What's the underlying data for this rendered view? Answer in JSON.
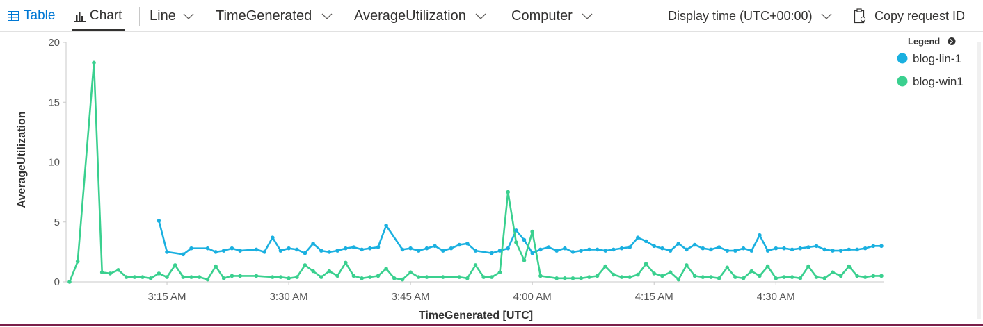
{
  "toolbar": {
    "table_label": "Table",
    "chart_label": "Chart",
    "chart_type_label": "Line",
    "x_column_label": "TimeGenerated",
    "y_column_label": "AverageUtilization",
    "split_column_label": "Computer",
    "display_time_label": "Display time (UTC+00:00)",
    "copy_request_label": "Copy request ID"
  },
  "colors": {
    "accent": "#0078d4",
    "series_lin": "#1ab0e0",
    "series_win": "#3ad08f"
  },
  "icons": [
    "table-icon",
    "chart-icon",
    "chevron-down-icon",
    "clipboard-icon",
    "legend-collapse-icon"
  ],
  "chart_data": {
    "type": "line",
    "xlabel": "TimeGenerated [UTC]",
    "ylabel": "AverageUtilization",
    "legend_title": "Legend",
    "legend_position": "top-right",
    "ylim": [
      0,
      20
    ],
    "xlim": [
      "03:03",
      "04:43"
    ],
    "x_ticks": [
      "3:15 AM",
      "3:30 AM",
      "3:45 AM",
      "4:00 AM",
      "4:15 AM",
      "4:30 AM"
    ],
    "y_ticks": [
      "0",
      "5",
      "10",
      "15",
      "20"
    ],
    "grid": false,
    "series": [
      {
        "name": "blog-lin-1",
        "color": "#1ab0e0",
        "x": [
          "03:14",
          "03:15",
          "03:17",
          "03:18",
          "03:20",
          "03:21",
          "03:22",
          "03:23",
          "03:24",
          "03:26",
          "03:27",
          "03:28",
          "03:29",
          "03:30",
          "03:31",
          "03:32",
          "03:33",
          "03:34",
          "03:35",
          "03:36",
          "03:37",
          "03:38",
          "03:39",
          "03:40",
          "03:41",
          "03:42",
          "03:44",
          "03:45",
          "03:46",
          "03:47",
          "03:48",
          "03:49",
          "03:50",
          "03:51",
          "03:52",
          "03:53",
          "03:55",
          "03:56",
          "03:57",
          "03:58",
          "03:59",
          "04:00",
          "04:01",
          "04:02",
          "04:03",
          "04:04",
          "04:05",
          "04:06",
          "04:07",
          "04:08",
          "04:09",
          "04:10",
          "04:11",
          "04:12",
          "04:13",
          "04:14",
          "04:15",
          "04:16",
          "04:17",
          "04:18",
          "04:19",
          "04:20",
          "04:21",
          "04:22",
          "04:23",
          "04:24",
          "04:25",
          "04:26",
          "04:27",
          "04:28",
          "04:29",
          "04:30",
          "04:31",
          "04:32",
          "04:33",
          "04:34",
          "04:35",
          "04:36",
          "04:37",
          "04:38",
          "04:39",
          "04:40",
          "04:41",
          "04:42",
          "04:43"
        ],
        "values": [
          5.1,
          2.5,
          2.3,
          2.8,
          2.8,
          2.5,
          2.6,
          2.8,
          2.6,
          2.7,
          2.5,
          3.7,
          2.6,
          2.8,
          2.7,
          2.4,
          3.2,
          2.6,
          2.5,
          2.6,
          2.8,
          2.9,
          2.7,
          2.8,
          2.9,
          4.7,
          2.7,
          2.8,
          2.6,
          2.8,
          3.0,
          2.6,
          2.8,
          3.1,
          3.2,
          2.6,
          2.4,
          2.6,
          2.8,
          4.3,
          3.5,
          2.4,
          2.7,
          2.9,
          2.6,
          2.8,
          2.5,
          2.6,
          2.7,
          2.7,
          2.6,
          2.7,
          2.8,
          2.9,
          3.7,
          3.4,
          3.0,
          2.8,
          2.6,
          3.2,
          2.7,
          3.1,
          2.8,
          2.7,
          2.9,
          2.6,
          2.6,
          2.8,
          2.6,
          3.9,
          2.6,
          2.8,
          2.8,
          2.7,
          2.8,
          2.9,
          3.0,
          2.7,
          2.6,
          2.6,
          2.7,
          2.7,
          2.8,
          3.0,
          3.0
        ],
        "values_note_hidden": ""
      },
      {
        "name": "blog-win1",
        "color": "#3ad08f",
        "x": [
          "03:03",
          "03:04",
          "03:06",
          "03:07",
          "03:08",
          "03:09",
          "03:10",
          "03:11",
          "03:12",
          "03:13",
          "03:14",
          "03:15",
          "03:16",
          "03:17",
          "03:18",
          "03:19",
          "03:20",
          "03:21",
          "03:22",
          "03:23",
          "03:24",
          "03:26",
          "03:28",
          "03:29",
          "03:30",
          "03:31",
          "03:32",
          "03:33",
          "03:34",
          "03:35",
          "03:36",
          "03:37",
          "03:38",
          "03:39",
          "03:40",
          "03:41",
          "03:42",
          "03:43",
          "03:44",
          "03:45",
          "03:46",
          "03:47",
          "03:49",
          "03:51",
          "03:52",
          "03:53",
          "03:54",
          "03:55",
          "03:56",
          "03:57",
          "03:58",
          "03:59",
          "04:00",
          "04:01",
          "04:03",
          "04:04",
          "04:05",
          "04:06",
          "04:07",
          "04:08",
          "04:09",
          "04:10",
          "04:11",
          "04:12",
          "04:13",
          "04:14",
          "04:15",
          "04:16",
          "04:17",
          "04:18",
          "04:19",
          "04:20",
          "04:21",
          "04:22",
          "04:23",
          "04:24",
          "04:25",
          "04:26",
          "04:27",
          "04:28",
          "04:29",
          "04:30",
          "04:31",
          "04:32",
          "04:33",
          "04:34",
          "04:35",
          "04:36",
          "04:37",
          "04:38",
          "04:39",
          "04:40",
          "04:41",
          "04:42",
          "04:43"
        ],
        "values": [
          0.0,
          1.7,
          18.3,
          0.8,
          0.7,
          1.0,
          0.4,
          0.4,
          0.4,
          0.3,
          0.7,
          0.4,
          1.4,
          0.4,
          0.4,
          0.4,
          0.2,
          1.3,
          0.3,
          0.5,
          0.5,
          0.5,
          0.4,
          0.4,
          0.3,
          0.4,
          1.4,
          0.9,
          0.4,
          0.9,
          0.5,
          1.6,
          0.5,
          0.3,
          0.4,
          0.5,
          1.1,
          0.3,
          0.2,
          0.8,
          0.4,
          0.4,
          0.4,
          0.4,
          0.3,
          1.4,
          0.4,
          0.4,
          0.8,
          7.5,
          3.3,
          1.8,
          4.2,
          0.5,
          0.3,
          0.3,
          0.3,
          0.3,
          0.4,
          0.5,
          1.3,
          0.6,
          0.4,
          0.4,
          0.6,
          1.5,
          0.7,
          0.5,
          0.8,
          0.2,
          1.4,
          0.5,
          0.4,
          0.4,
          0.3,
          1.2,
          0.4,
          0.3,
          0.9,
          0.5,
          1.3,
          0.3,
          0.4,
          0.4,
          0.3,
          1.3,
          0.4,
          0.3,
          0.8,
          0.5,
          1.3,
          0.5,
          0.4,
          0.5,
          0.5
        ]
      }
    ]
  }
}
